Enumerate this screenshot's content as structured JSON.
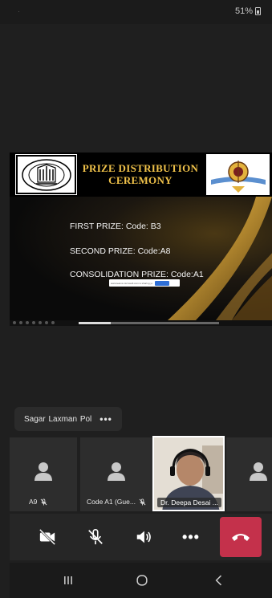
{
  "status_bar": {
    "left": "·",
    "battery": "51%"
  },
  "presentation": {
    "title_line1": "PRIZE DISTRIBUTION",
    "title_line2": "CEREMONY",
    "prizes": [
      "FIRST PRIZE: Code: B3",
      "SECOND PRIZE: Code:A8",
      "CONSOLIDATION PRIZE: Code:A1"
    ],
    "share_bar_text": "www.teams.microsoft.com is sharing your screen",
    "share_bar_button": "Stop sharing",
    "share_bar_hide": "Hide"
  },
  "presenter_pill": {
    "name": "Sagar  Laxman Pol",
    "more": "•••"
  },
  "tiles": [
    {
      "label": "A9"
    },
    {
      "label": "Code A1 (Gue..."
    },
    {
      "label": "Dr. Deepa Desai ..."
    }
  ],
  "controls": {
    "more": "•••"
  },
  "colors": {
    "accent_gold": "#f0c24a",
    "hangup": "#c4314b",
    "background": "#1f1f1f"
  }
}
